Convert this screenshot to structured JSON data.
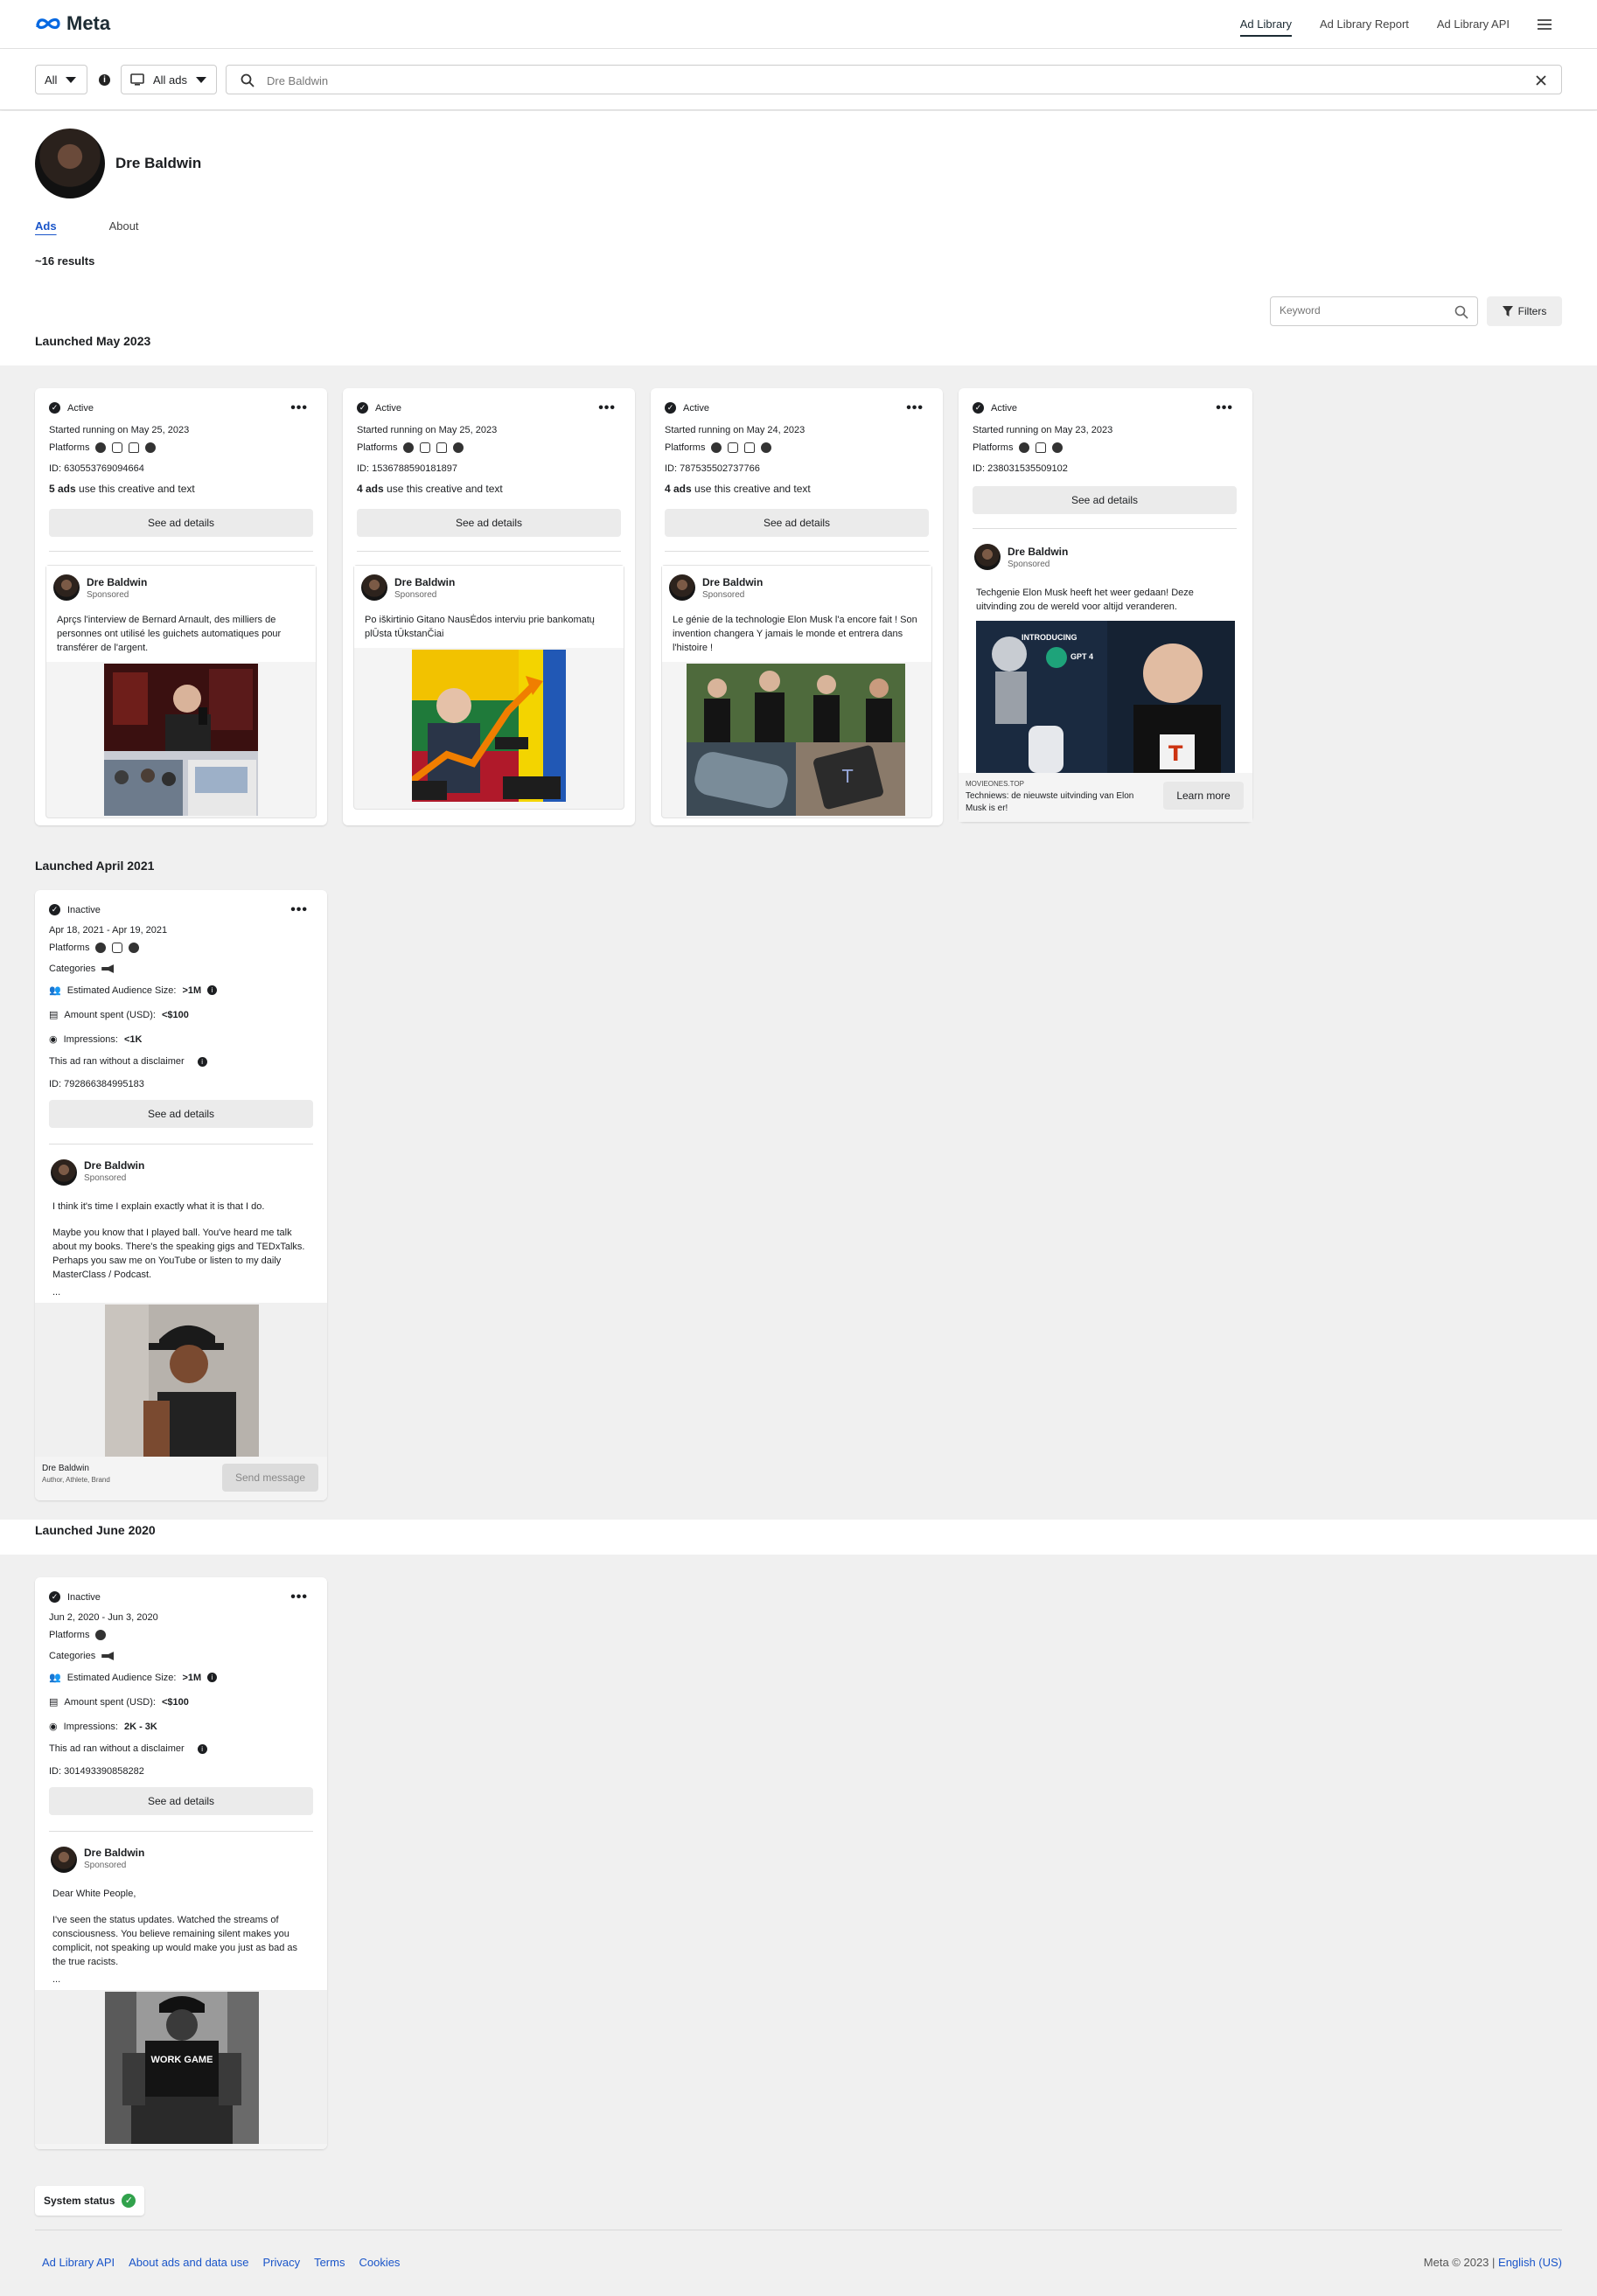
{
  "header": {
    "brand": "Meta",
    "nav": [
      "Ad Library",
      "Ad Library Report",
      "Ad Library API"
    ]
  },
  "search": {
    "country": "All",
    "ad_type": "All ads",
    "query": "Dre Baldwin"
  },
  "profile": {
    "name": "Dre Baldwin",
    "tabs": [
      "Ads",
      "About"
    ],
    "results": "~16 results",
    "keyword_placeholder": "Keyword",
    "filters_label": "Filters"
  },
  "sections": {
    "may2023": "Launched May 2023",
    "apr2021": "Launched April 2021",
    "jun2020": "Launched June 2020"
  },
  "common": {
    "platforms": "Platforms",
    "categories": "Categories",
    "see_details": "See ad details",
    "sponsored": "Sponsored",
    "advertiser": "Dre Baldwin",
    "use_text": "use this creative and text",
    "aud_label": "Estimated Audience Size:",
    "spent_label": "Amount spent (USD):",
    "impr_label": "Impressions:",
    "disclaimer": "This ad ran without a disclaimer"
  },
  "cards": [
    {
      "status": "Active",
      "started": "Started running on May 25, 2023",
      "id": "ID: 630553769094664",
      "ads_count": "5 ads",
      "text": "Aprçs l'interview de Bernard Arnault, des milliers de personnes ont utilisé les guichets automatiques pour transférer de l'argent."
    },
    {
      "status": "Active",
      "started": "Started running on May 25, 2023",
      "id": "ID: 1536788590181897",
      "ads_count": "4 ads",
      "text": "Po iškirtinio Gitano NausĖdos interviu prie bankomatų plŪsta tŪkstanČiai"
    },
    {
      "status": "Active",
      "started": "Started running on May 24, 2023",
      "id": "ID: 787535502737766",
      "ads_count": "4 ads",
      "text": "Le génie de la technologie Elon Musk l'a encore fait ! Son invention changera Y jamais le monde et entrera dans l'histoire !"
    },
    {
      "status": "Active",
      "started": "Started running on May 23, 2023",
      "id": "ID: 238031535509102",
      "text": "Techgenie Elon Musk heeft het weer gedaan! Deze uitvinding zou de wereld voor altijd veranderen.",
      "link_domain": "MOVIEONES.TOP",
      "link_title": "Techniews: de nieuwste uitvinding van Elon Musk is er!",
      "cta": "Learn more",
      "img_text": "INTRODUCING",
      "img_gpt": "GPT 4"
    },
    {
      "status": "Inactive",
      "dates": "Apr 18, 2021 - Apr 19, 2021",
      "audience": ">1M",
      "spent": "<$100",
      "impressions": "<1K",
      "id": "ID: 792866384995183",
      "text1": "I think it's time I explain exactly what it is that I do.",
      "text2": "Maybe you know that I played ball. You've heard me talk about my books. There's the speaking gigs and TEDxTalks. Perhaps you saw me on YouTube or listen to my daily MasterClass / Podcast.",
      "ellipsis": "...",
      "footer_name": "Dre Baldwin",
      "footer_sub": "Author, Athlete, Brand",
      "cta": "Send message"
    },
    {
      "status": "Inactive",
      "dates": "Jun 2, 2020 - Jun 3, 2020",
      "audience": ">1M",
      "spent": "<$100",
      "impressions": "2K - 3K",
      "id": "ID: 301493390858282",
      "text1": "Dear White People,",
      "text2": "I've seen the status updates. Watched the streams of consciousness. You believe remaining silent makes you complicit, not speaking up would make you just as bad as the true racists.",
      "ellipsis": "...",
      "img_text": "WORK GAME"
    }
  ],
  "footer": {
    "system_status": "System status",
    "links": [
      "Ad Library API",
      "About ads and data use",
      "Privacy",
      "Terms",
      "Cookies"
    ],
    "copyright": "Meta © 2023 |",
    "language": "English (US)"
  },
  "colors": {
    "link_blue": "#1a55c9",
    "status_green": "#31a24c"
  }
}
